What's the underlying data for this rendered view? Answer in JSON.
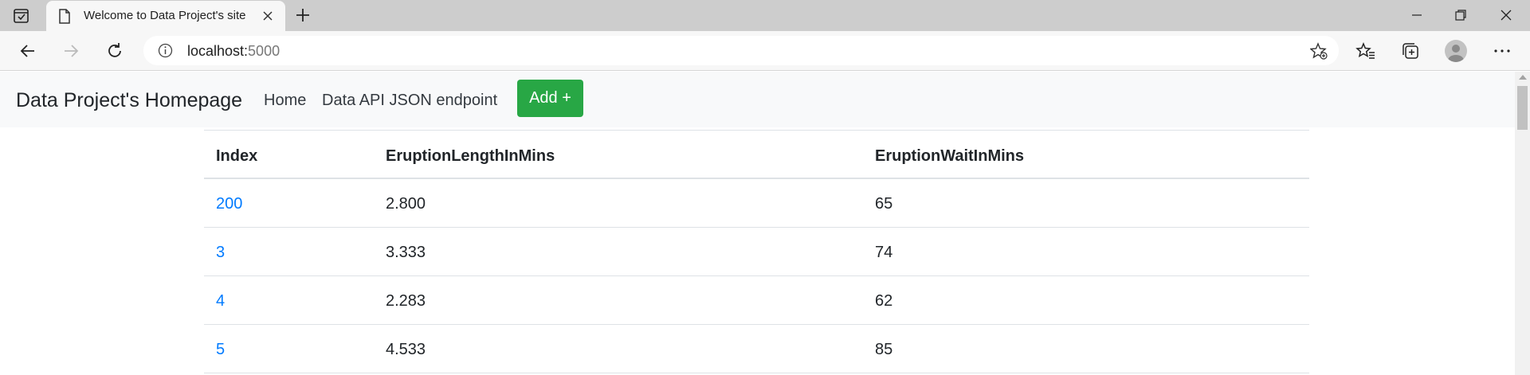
{
  "browser": {
    "tab_title": "Welcome to Data Project's site",
    "url_host": "localhost:",
    "url_port": "5000",
    "icons": [
      "tab-actions-icon",
      "page-icon",
      "close-icon",
      "plus-icon",
      "minimize-icon",
      "restore-icon",
      "window-close-icon",
      "back-icon",
      "forward-icon",
      "reload-icon",
      "info-icon",
      "favorite-add-icon",
      "favorites-icon",
      "collections-icon",
      "profile-icon",
      "more-icon"
    ]
  },
  "navbar": {
    "brand": "Data Project's Homepage",
    "links": [
      "Home",
      "Data API JSON endpoint"
    ],
    "add_button": "Add +"
  },
  "table": {
    "headers": [
      "Index",
      "EruptionLengthInMins",
      "EruptionWaitInMins"
    ],
    "rows": [
      [
        "200",
        "2.800",
        "65"
      ],
      [
        "3",
        "3.333",
        "74"
      ],
      [
        "4",
        "2.283",
        "62"
      ],
      [
        "5",
        "4.533",
        "85"
      ]
    ]
  },
  "colors": {
    "link": "#007bff",
    "add_button": "#28a745",
    "navbar_bg": "#f8f9fa",
    "tabbar_bg": "#cdcdcd"
  }
}
